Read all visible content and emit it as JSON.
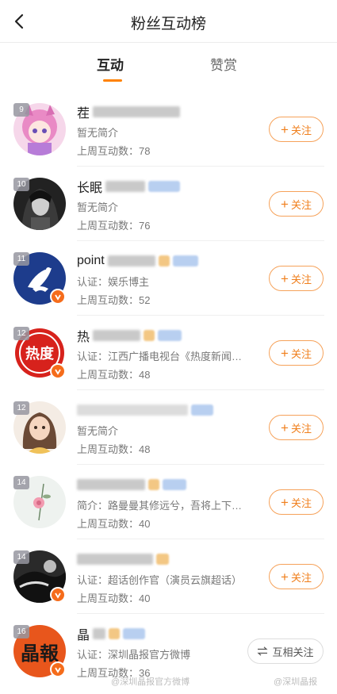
{
  "header": {
    "title": "粉丝互动榜",
    "back_icon": "back-arrow-icon"
  },
  "tabs": [
    {
      "label": "互动",
      "active": true
    },
    {
      "label": "赞赏",
      "active": false
    }
  ],
  "accent_color": "#ff8200",
  "follow_label": "关注",
  "mutual_label": "互相关注",
  "rows": [
    {
      "rank": "9",
      "name": "茬",
      "intro": "暂无简介",
      "count_label": "上周互动数：78",
      "verified": false
    },
    {
      "rank": "10",
      "name": "长眠",
      "intro": "暂无简介",
      "count_label": "上周互动数：76",
      "verified": false
    },
    {
      "rank": "11",
      "name": "point",
      "intro": "认证：娱乐博主",
      "count_label": "上周互动数：52",
      "verified": true
    },
    {
      "rank": "12",
      "name": "热",
      "intro": "认证：江西广播电视台《热度新闻…",
      "count_label": "上周互动数：48",
      "verified": true
    },
    {
      "rank": "12",
      "name": "",
      "intro": "暂无简介",
      "count_label": "上周互动数：48",
      "verified": false
    },
    {
      "rank": "14",
      "name": "",
      "intro": "简介：路曼曼其修远兮，吾将上下…",
      "count_label": "上周互动数：40",
      "verified": false
    },
    {
      "rank": "14",
      "name": "",
      "intro": "认证：超话创作官（演员云旗超话）",
      "count_label": "上周互动数：40",
      "verified": true
    },
    {
      "rank": "16",
      "name": "晶",
      "intro": "认证：深圳晶报官方微博",
      "count_label": "上周互动数：36",
      "verified": true,
      "mutual": true
    }
  ],
  "avatars": {
    "row3_text": "热度",
    "row7_text": "晶報"
  },
  "watermarks": {
    "left": "@深圳晶报官方微博",
    "right": "@深圳晶报"
  }
}
